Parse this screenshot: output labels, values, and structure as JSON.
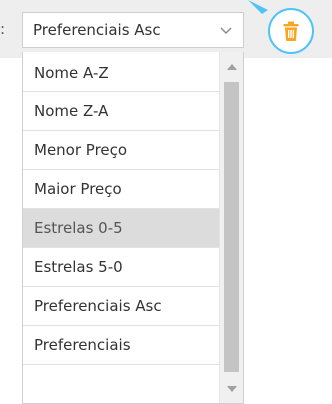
{
  "sort": {
    "label_suffix": ":",
    "selected": "Preferenciais Asc",
    "options": [
      "Nome A-Z",
      "Nome Z-A",
      "Menor Preço",
      "Maior Preço",
      "Estrelas 0-5",
      "Estrelas 5-0",
      "Preferenciais Asc",
      "Preferenciais"
    ],
    "hovered_option": "Estrelas 0-5"
  },
  "colors": {
    "background_band": "#eeeeee",
    "trash_icon": "#f5a623",
    "trash_ring": "#4fc3f7",
    "hover_row": "#dcdcdc",
    "scroll_thumb": "#c4c4c4"
  },
  "icons": {
    "select_chevron": "chevron-down-icon",
    "delete": "trash-icon",
    "scroll_up": "scroll-up-arrow-icon",
    "scroll_down": "scroll-down-arrow-icon"
  }
}
